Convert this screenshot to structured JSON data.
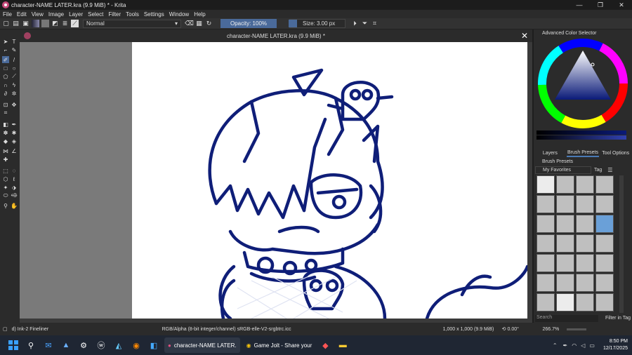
{
  "window": {
    "title": "character-NAME LATER.kra (9.9 MiB) * - Krita",
    "minimize": "—",
    "maximize": "❐",
    "close": "✕"
  },
  "menu": [
    "File",
    "Edit",
    "View",
    "Image",
    "Layer",
    "Select",
    "Filter",
    "Tools",
    "Settings",
    "Window",
    "Help"
  ],
  "toolbar": {
    "blend_mode": "Normal",
    "opacity": "Opacity: 100%",
    "size": "Size: 3.00 px"
  },
  "document": {
    "tab_title": "character-NAME LATER.kra (9.9 MiB) *",
    "stroke_color": "#0f1e78"
  },
  "dock": {
    "color_selector_title": "Advanced Color Selector",
    "tabs": [
      "Layers",
      "Brush Presets",
      "Tool Options"
    ],
    "active_tab": "Brush Presets",
    "brush_presets_title": "Brush Presets",
    "tag_filter": "My Favorites",
    "tag_button": "Tag",
    "search_placeholder": "Search",
    "filter_in_tag": "Filter in Tag"
  },
  "status": {
    "brush": "d) Ink-2 Fineliner",
    "color_space": "RGB/Alpha (8-bit integer/channel)  sRGB-elle-V2-srgbtrc.icc",
    "dims": "1,000 x 1,000 (9.9 MiB)",
    "rotation": "0.00°",
    "zoom": "266.7%"
  },
  "taskbar": {
    "krita_label": "character-NAME LATER.",
    "chrome_label": "Game Jolt - Share your",
    "time": "8:50 PM",
    "date": "12/17/2025"
  }
}
